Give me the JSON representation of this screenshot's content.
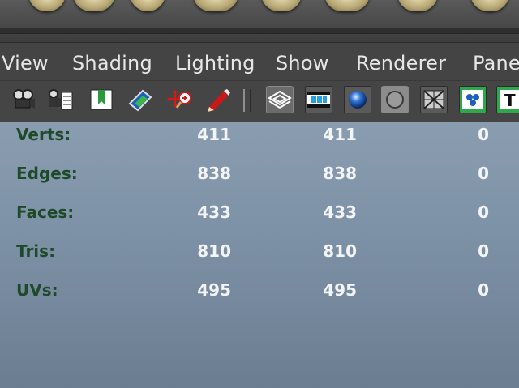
{
  "menu": {
    "items": [
      {
        "label": "View"
      },
      {
        "label": "Shading"
      },
      {
        "label": "Lighting"
      },
      {
        "label": "Show"
      },
      {
        "label": "Renderer"
      },
      {
        "label": "Pane"
      }
    ]
  },
  "toolbar": {
    "icons": [
      "select-camera-icon",
      "camera-attributes-icon",
      "bookmarks-icon",
      "image-plane-icon",
      "2d-pan-zoom-icon",
      "grease-pencil-icon",
      "wireframe-icon",
      "smooth-shade-icon",
      "default-material-icon",
      "xray-icon",
      "textured-icon",
      "use-lights-icon",
      "text-icon"
    ]
  },
  "hud": {
    "rows": [
      {
        "label": "Verts:",
        "a": "411",
        "b": "411",
        "c": "0"
      },
      {
        "label": "Edges:",
        "a": "838",
        "b": "838",
        "c": "0"
      },
      {
        "label": "Faces:",
        "a": "433",
        "b": "433",
        "c": "0"
      },
      {
        "label": "Tris:",
        "a": "810",
        "b": "810",
        "c": "0"
      },
      {
        "label": "UVs:",
        "a": "495",
        "b": "495",
        "c": "0"
      }
    ]
  },
  "colors": {
    "hud_label": "#1f4a2a",
    "hud_value": "#f2f4f6",
    "viewport_top": "#8a9db0",
    "viewport_bottom": "#6b7d91"
  }
}
